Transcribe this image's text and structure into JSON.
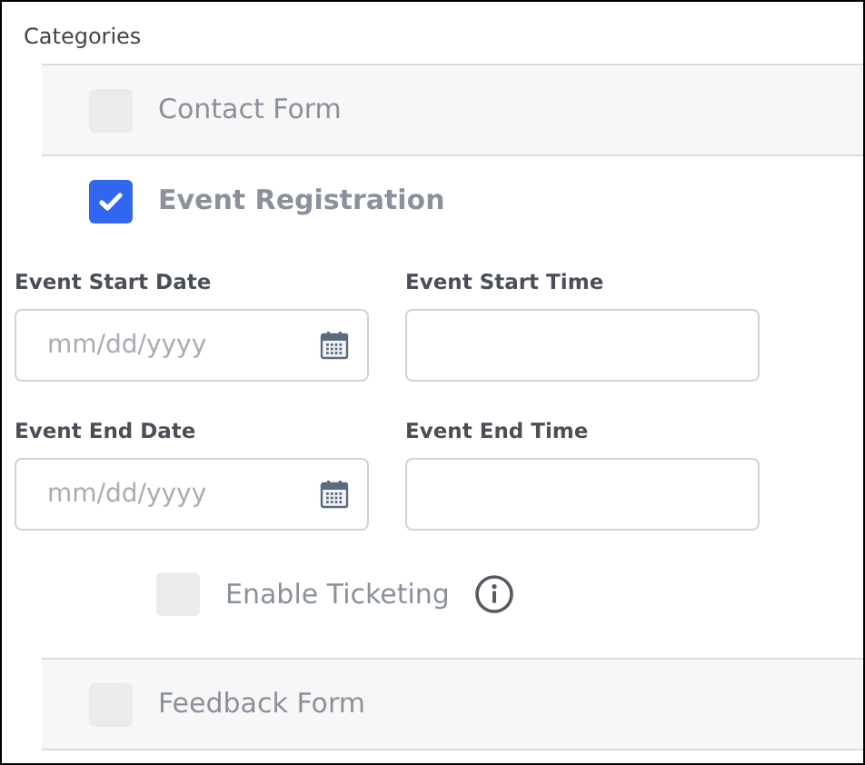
{
  "title": "Categories",
  "categories": [
    {
      "label": "Contact Form",
      "checked": false
    },
    {
      "label": "Event Registration",
      "checked": true,
      "fields": [
        {
          "label": "Event Start Date",
          "kind": "date",
          "placeholder": "mm/dd/yyyy"
        },
        {
          "label": "Event Start Time",
          "kind": "time"
        },
        {
          "label": "Event End Date",
          "kind": "date",
          "placeholder": "mm/dd/yyyy"
        },
        {
          "label": "Event End Time",
          "kind": "time"
        }
      ],
      "options": [
        {
          "label": "Enable Ticketing",
          "checked": false,
          "info": true
        }
      ]
    },
    {
      "label": "Feedback Form",
      "checked": false
    }
  ]
}
